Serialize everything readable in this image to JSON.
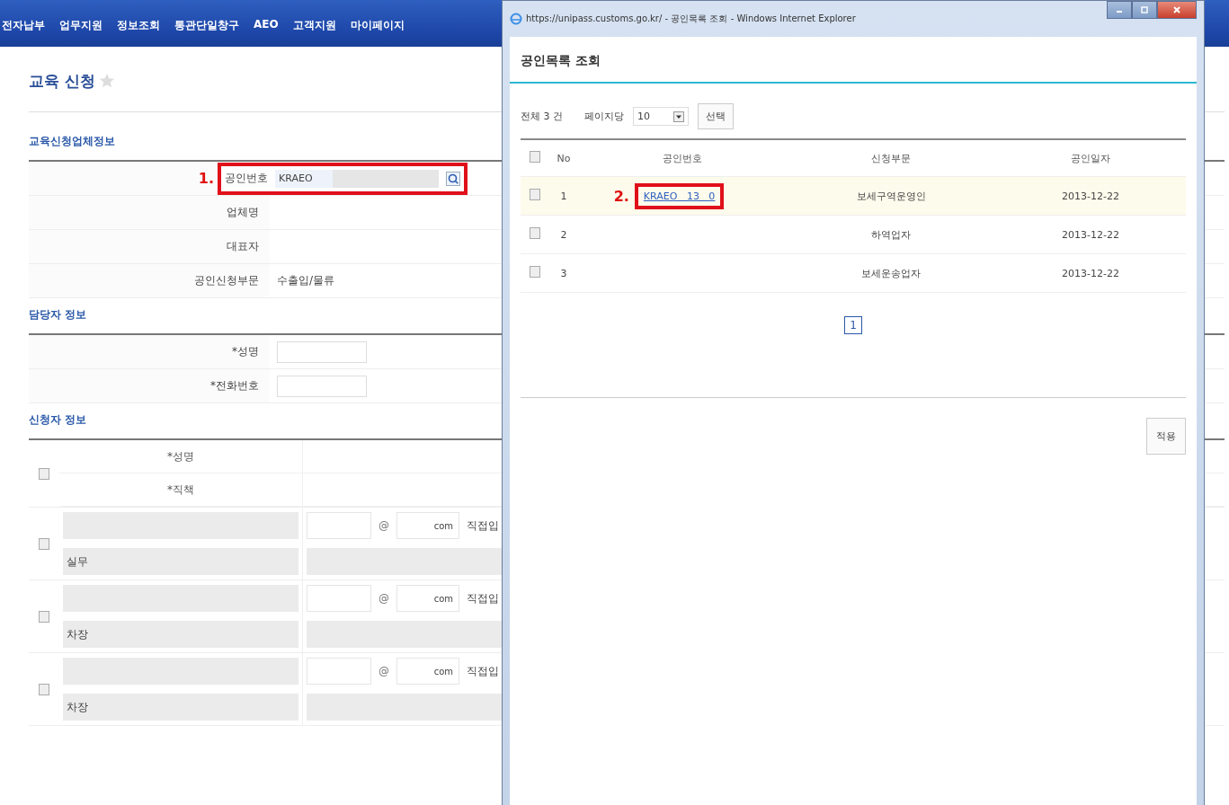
{
  "nav": [
    "전자납부",
    "업무지원",
    "정보조회",
    "통관단일창구",
    "AEO",
    "고객지원",
    "마이페이지"
  ],
  "page": {
    "title": "교육 신청",
    "company_section": {
      "heading": "교육신청업체정보",
      "annotation": "1.",
      "rows": [
        {
          "label": "공인번호",
          "kind": "search",
          "value": "KRAEO"
        },
        {
          "label": "업체명",
          "kind": "text"
        },
        {
          "label": "대표자",
          "kind": "text"
        },
        {
          "label": "공인신청부문",
          "kind": "text",
          "value": "수출입/물류"
        }
      ]
    },
    "contact_section": {
      "heading": "담당자 정보",
      "rows": [
        {
          "label": "*성명"
        },
        {
          "label": "*전화번호"
        }
      ]
    },
    "applicant_section": {
      "heading": "신청자 정보",
      "header": {
        "checked": false,
        "labels": [
          "*성명",
          "*직책"
        ]
      },
      "rows": [
        {
          "checked": false,
          "position": "실무",
          "at": "@",
          "domain": "com",
          "domain_select": "직접입"
        },
        {
          "checked": false,
          "position": "차장",
          "at": "@",
          "domain": "com",
          "domain_select": "직접입"
        },
        {
          "checked": false,
          "position": "차장",
          "at": "@",
          "domain": "com",
          "domain_select": "직접입"
        }
      ]
    }
  },
  "popup": {
    "window_title": "https://unipass.customs.go.kr/ - 공인목록 조회 - Windows Internet Explorer",
    "heading": "공인목록 조회",
    "total": "전체 3 건",
    "per_page_label": "페이지당",
    "per_page": "10",
    "select_button": "선택",
    "columns": [
      "No",
      "공인번호",
      "신청부문",
      "공인일자"
    ],
    "header_checked": false,
    "annotation": "2.",
    "rows": [
      {
        "checked": false,
        "selected": true,
        "no": "1",
        "number": "KRAEO   13   0",
        "division": "보세구역운영인",
        "date": "2013-12-22"
      },
      {
        "checked": false,
        "selected": false,
        "no": "2",
        "division": "하역업자",
        "date": "2013-12-22"
      },
      {
        "checked": false,
        "selected": false,
        "no": "3",
        "division": "보세운송업자",
        "date": "2013-12-22"
      }
    ],
    "pages": [
      {
        "label": "1",
        "selected": true
      }
    ],
    "apply_button": "적용"
  }
}
